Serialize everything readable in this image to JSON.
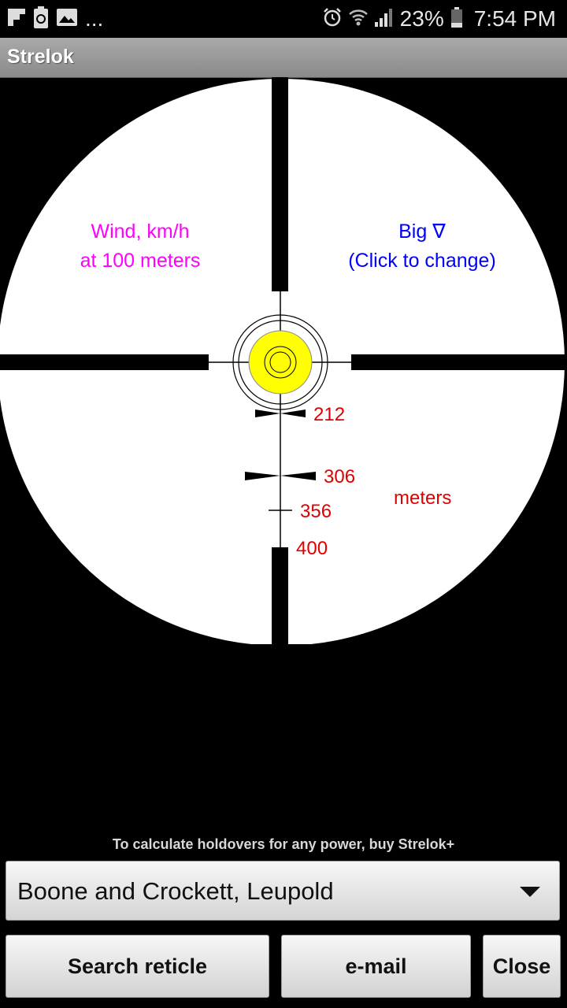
{
  "status_bar": {
    "battery_percent": "23%",
    "time": "7:54 PM",
    "left_icons": [
      "flipboard-icon",
      "recycle-battery-icon",
      "gallery-icon",
      "more-notifications-icon"
    ],
    "more_text": "...",
    "right_icons": [
      "alarm-icon",
      "wifi-icon",
      "cellular-signal-icon",
      "battery-icon"
    ]
  },
  "app": {
    "title": "Strelok"
  },
  "reticle": {
    "wind_label_line1": "Wind, km/h",
    "wind_label_line2": "at 100 meters",
    "big_label_line1": "Big ∇",
    "big_label_line2": "(Click to change)",
    "range_marks": [
      "212",
      "306",
      "356",
      "400"
    ],
    "units_label": "meters",
    "colors": {
      "wind_label": "#ff00ff",
      "big_label": "#0000ff",
      "range_labels": "#e00000",
      "center_dot": "#ffff00"
    }
  },
  "promo_text": "To calculate holdovers for any power, buy Strelok+",
  "reticle_select": {
    "selected": "Boone and Crockett, Leupold"
  },
  "buttons": {
    "search": "Search reticle",
    "email": "e-mail",
    "close": "Close"
  }
}
